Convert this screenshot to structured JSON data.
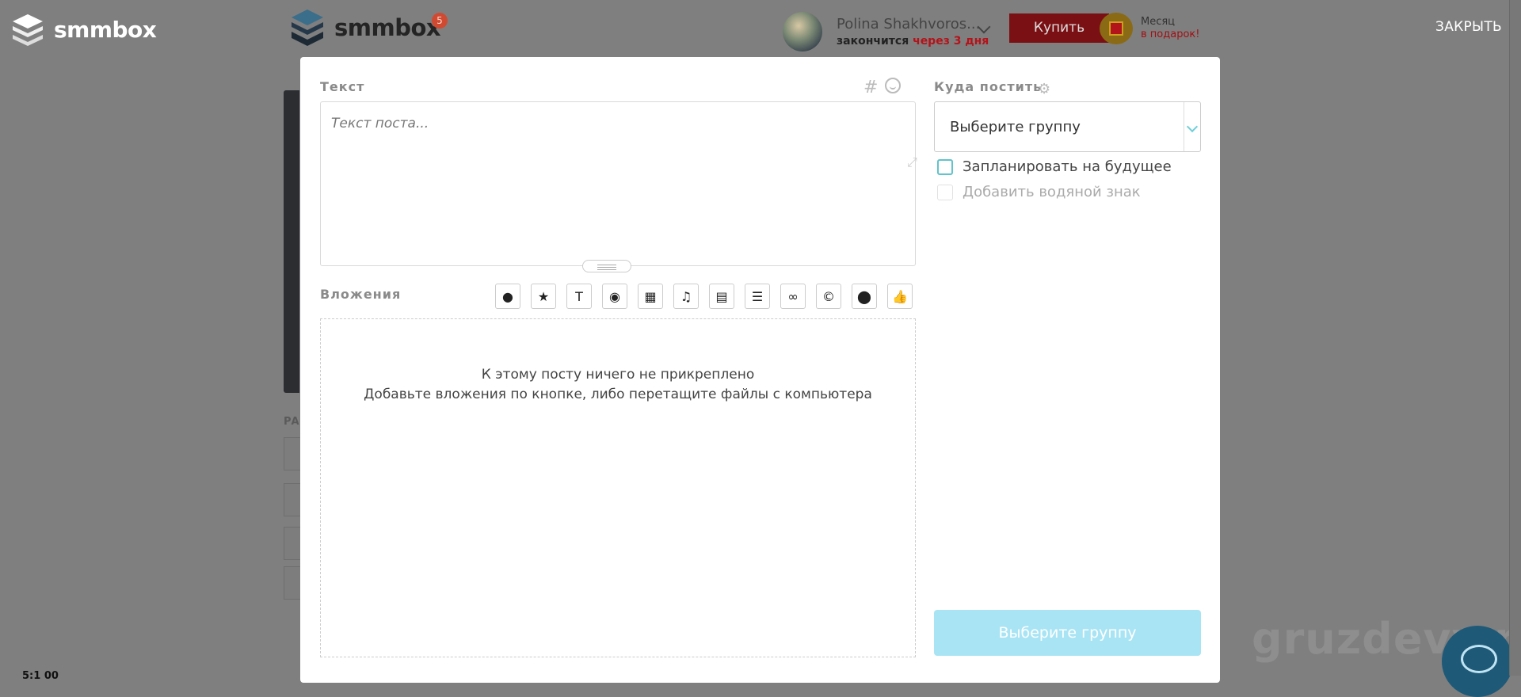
{
  "header": {
    "side_logo_text": "smmbox",
    "main_logo_text": "smmbox",
    "notification_count": "5",
    "user_name": "Polina Shakhvoros...",
    "expire_prefix": "закончится",
    "expire_highlight": "через 3 дня",
    "buy_label": "Купить",
    "gift_line1": "Месяц",
    "gift_line2": "в подарок!",
    "close_label": "ЗАКРЫТЬ"
  },
  "background": {
    "section_label": "РА",
    "time_text": "5:1 00",
    "watermark": "gruzdevv.ru"
  },
  "editor": {
    "text_label": "Текст",
    "text_placeholder": "Текст поста...",
    "hash_symbol": "#",
    "attachments_label": "Вложения",
    "tools": [
      {
        "name": "comment-icon",
        "glyph": "●"
      },
      {
        "name": "star-icon",
        "glyph": "★"
      },
      {
        "name": "text-icon",
        "glyph": "T"
      },
      {
        "name": "camera-icon",
        "glyph": "◉"
      },
      {
        "name": "film-icon",
        "glyph": "▦"
      },
      {
        "name": "music-icon",
        "glyph": "♫"
      },
      {
        "name": "document-icon",
        "glyph": "▤"
      },
      {
        "name": "list-icon",
        "glyph": "☰"
      },
      {
        "name": "link-icon",
        "glyph": "∞"
      },
      {
        "name": "copyright-icon",
        "glyph": "©"
      },
      {
        "name": "location-pin-icon",
        "glyph": "⬤"
      },
      {
        "name": "thumbs-up-icon",
        "glyph": "👍"
      }
    ],
    "empty_line1": "К этому посту ничего не прикреплено",
    "empty_line2": "Добавьте вложения по кнопке, либо перетащите файлы с компьютера"
  },
  "post_settings": {
    "where_label": "Куда постить",
    "group_select_value": "Выберите группу",
    "schedule_label": "Запланировать на будущее",
    "schedule_checked": false,
    "watermark_label": "Добавить водяной знак",
    "watermark_checked": false,
    "submit_label": "Выберите группу"
  },
  "colors": {
    "accent": "#61c3cc",
    "submit_disabled": "#a9e4f5",
    "buy_red": "#7b1014",
    "overlay": "#7f7f7f"
  }
}
